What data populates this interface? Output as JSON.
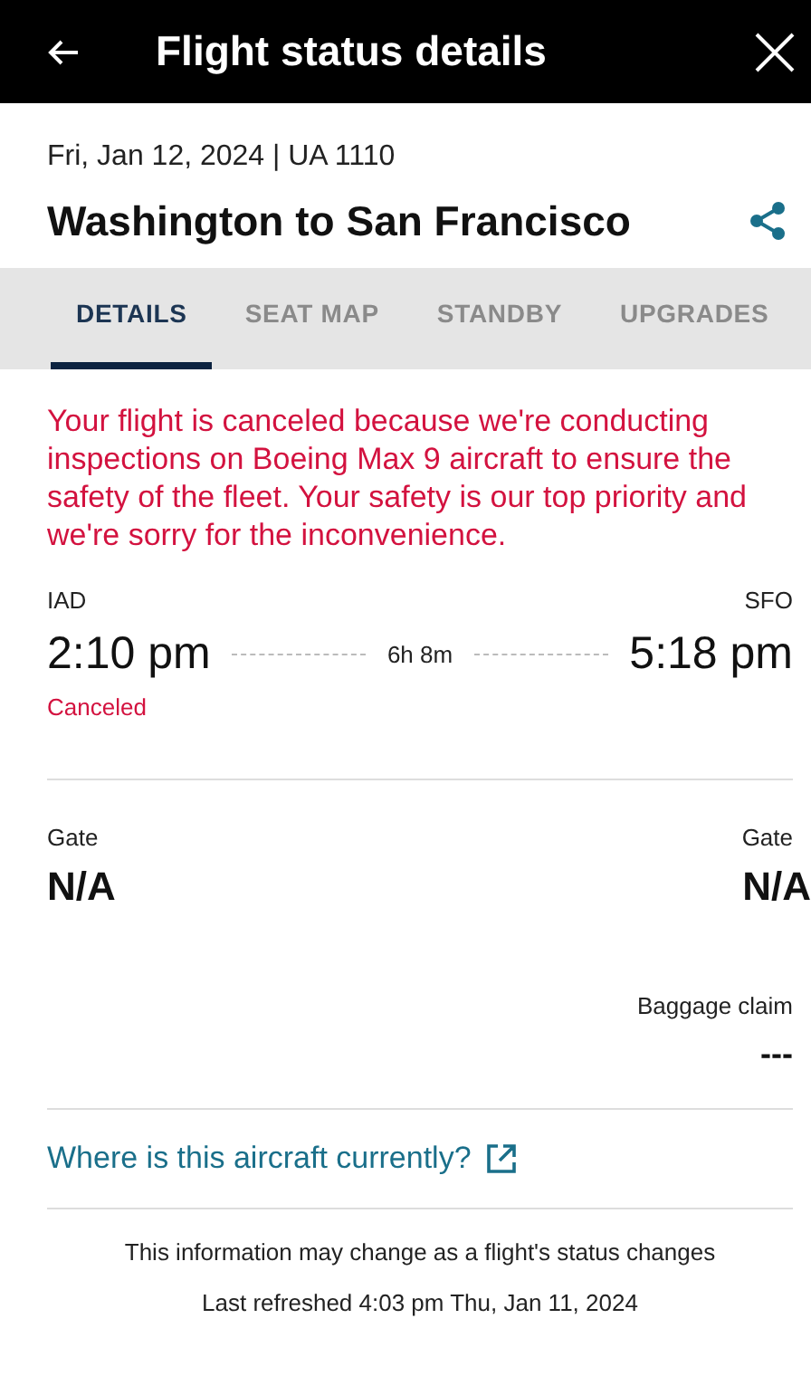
{
  "header": {
    "title": "Flight status details"
  },
  "flight": {
    "date_flight": "Fri, Jan 12, 2024 | UA 1110",
    "route": "Washington to San Francisco"
  },
  "tabs": [
    {
      "label": "DETAILS",
      "selected": true
    },
    {
      "label": "SEAT MAP",
      "selected": false
    },
    {
      "label": "STANDBY",
      "selected": false
    },
    {
      "label": "UPGRADES",
      "selected": false
    }
  ],
  "alert": "Your flight is canceled because we're conducting inspections on Boeing Max 9 aircraft to ensure the safety of the fleet. Your safety is our top priority and we're sorry for the inconvenience.",
  "departure": {
    "airport": "IAD",
    "time": "2:10 pm",
    "status": "Canceled"
  },
  "duration": "6h 8m",
  "arrival": {
    "airport": "SFO",
    "time": "5:18 pm"
  },
  "departure_gate": {
    "label": "Gate",
    "value": "N/A"
  },
  "arrival_gate": {
    "label": "Gate",
    "value": "N/A"
  },
  "baggage_claim": {
    "label": "Baggage claim",
    "value": "---"
  },
  "aircraft_link": "Where is this aircraft currently?",
  "footer": [
    "This information may change as a flight's status changes",
    "Last refreshed 4:03 pm Thu, Jan 11, 2024"
  ]
}
